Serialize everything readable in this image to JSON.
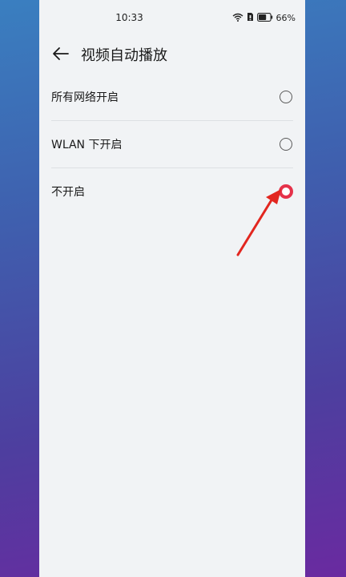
{
  "status_bar": {
    "time": "10:33",
    "battery_percent": "66%",
    "battery_level": 0.66,
    "icons": [
      "wifi-icon",
      "sim-icon",
      "battery-icon"
    ]
  },
  "header": {
    "back_icon": "arrow-left-icon",
    "title": "视频自动播放"
  },
  "options": [
    {
      "label": "所有网络开启",
      "selected": false
    },
    {
      "label": "WLAN 下开启",
      "selected": false
    },
    {
      "label": "不开启",
      "selected": true
    }
  ],
  "colors": {
    "accent": "#e5324a",
    "annotation_arrow": "#e2261f",
    "page_background": "#f1f3f5"
  }
}
